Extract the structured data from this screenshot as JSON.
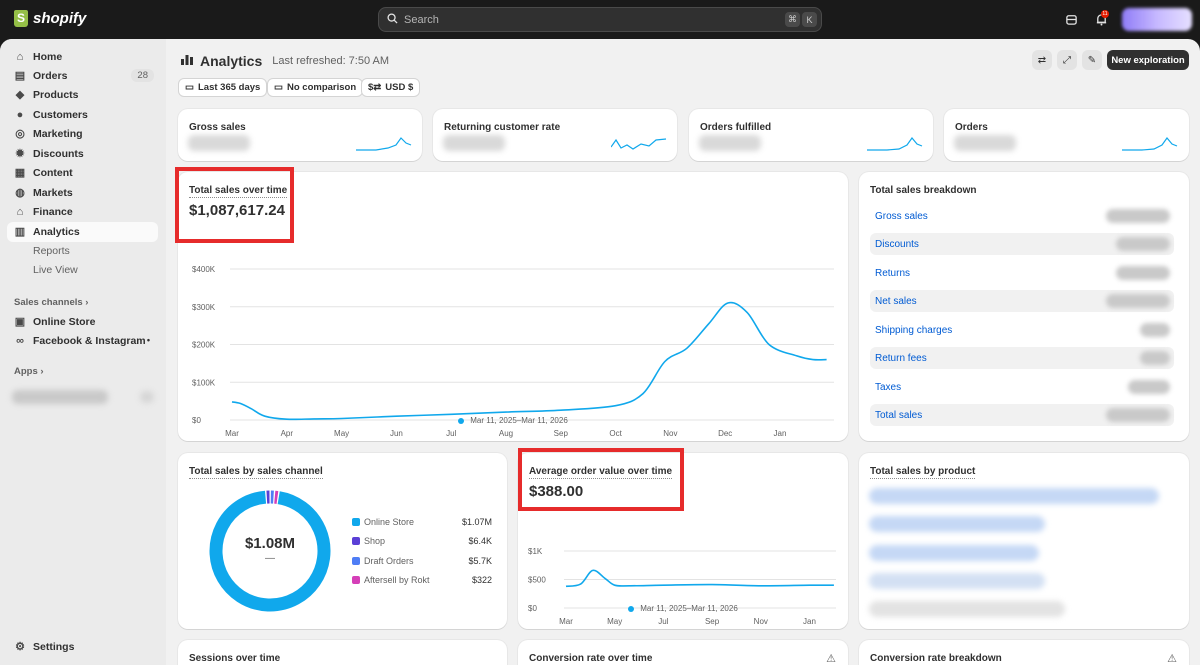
{
  "topbar": {
    "logo_text": "shopify",
    "search_placeholder": "Search",
    "kbd_cmd": "⌘",
    "kbd_k": "K",
    "notif_count": "11"
  },
  "sidebar": {
    "items": [
      {
        "label": "Home",
        "icon": "home-icon"
      },
      {
        "label": "Orders",
        "icon": "orders-icon",
        "count": "28"
      },
      {
        "label": "Products",
        "icon": "tag-icon"
      },
      {
        "label": "Customers",
        "icon": "person-icon"
      },
      {
        "label": "Marketing",
        "icon": "target-icon"
      },
      {
        "label": "Discounts",
        "icon": "discount-icon"
      },
      {
        "label": "Content",
        "icon": "content-icon"
      },
      {
        "label": "Markets",
        "icon": "globe-icon"
      },
      {
        "label": "Finance",
        "icon": "bank-icon"
      },
      {
        "label": "Analytics",
        "icon": "chart-icon"
      }
    ],
    "sub_items": [
      "Reports",
      "Live View"
    ],
    "sales_channels_label": "Sales channels",
    "channels": [
      "Online Store",
      "Facebook & Instagram"
    ],
    "apps_label": "Apps",
    "settings_label": "Settings"
  },
  "header": {
    "title": "Analytics",
    "refreshed": "Last refreshed: 7:50 AM",
    "new_exploration": "New exploration",
    "filters": [
      "Last 365 days",
      "No comparison",
      "USD $"
    ]
  },
  "metric_cards": [
    "Gross sales",
    "Returning customer rate",
    "Orders fulfilled",
    "Orders"
  ],
  "total_sales": {
    "title": "Total sales over time",
    "value": "$1,087,617.24",
    "legend": "Mar 11, 2025–Mar 11, 2026"
  },
  "breakdown": {
    "title": "Total sales breakdown",
    "rows": [
      "Gross sales",
      "Discounts",
      "Returns",
      "Net sales",
      "Shipping charges",
      "Return fees",
      "Taxes",
      "Total sales"
    ]
  },
  "channel_card": {
    "title": "Total sales by sales channel",
    "center_value": "$1.08M",
    "center_sub": "—",
    "legend": [
      {
        "name": "Online Store",
        "value": "$1.07M",
        "color": "#10a8ec"
      },
      {
        "name": "Shop",
        "value": "$6.4K",
        "color": "#5a3fd6"
      },
      {
        "name": "Draft Orders",
        "value": "$5.7K",
        "color": "#4f7df5"
      },
      {
        "name": "Aftersell by Rokt",
        "value": "$322",
        "color": "#d53fb8"
      }
    ]
  },
  "aov": {
    "title": "Average order value over time",
    "value": "$388.00",
    "legend": "Mar 11, 2025–Mar 11, 2026"
  },
  "product_card": {
    "title": "Total sales by product"
  },
  "bottom_cards": [
    "Sessions over time",
    "Conversion rate over time",
    "Conversion rate breakdown"
  ],
  "chart_data": [
    {
      "type": "line",
      "title": "Total sales over time",
      "x": [
        "Mar",
        "Apr",
        "May",
        "Jun",
        "Jul",
        "Aug",
        "Sep",
        "Oct",
        "Nov",
        "Dec",
        "Jan"
      ],
      "yticks": [
        "$0",
        "$100K",
        "$200K",
        "$300K",
        "$400K"
      ],
      "ylim": [
        0,
        400000
      ],
      "series": [
        {
          "name": "Mar 11, 2025–Mar 11, 2026",
          "color": "#10a8ec",
          "x": [
            0,
            0.15,
            0.35,
            0.6,
            1,
            1.5,
            2,
            3,
            4,
            5,
            6,
            7,
            7.5,
            7.9,
            8.3,
            8.7,
            9.05,
            9.4,
            9.8,
            10.3,
            10.6,
            10.85
          ],
          "values": [
            48000,
            44000,
            30000,
            10000,
            2000,
            3000,
            4000,
            10000,
            15000,
            21000,
            26000,
            38000,
            70000,
            155000,
            190000,
            255000,
            310000,
            285000,
            200000,
            170000,
            160000,
            160000
          ]
        }
      ],
      "grid": true
    },
    {
      "type": "line",
      "title": "Average order value over time",
      "x": [
        "Mar",
        "May",
        "Jul",
        "Sep",
        "Nov",
        "Jan"
      ],
      "yticks": [
        "$0",
        "$500",
        "$1K"
      ],
      "ylim": [
        0,
        1000
      ],
      "series": [
        {
          "name": "Mar 11, 2025–Mar 11, 2026",
          "color": "#10a8ec",
          "x": [
            0,
            0.3,
            0.55,
            0.8,
            1.0,
            1.3,
            2,
            3,
            4,
            5,
            5.5
          ],
          "values": [
            380,
            420,
            660,
            520,
            400,
            390,
            400,
            410,
            390,
            400,
            400
          ]
        }
      ],
      "grid": true
    },
    {
      "type": "pie",
      "title": "Total sales by sales channel",
      "categories": [
        "Online Store",
        "Shop",
        "Draft Orders",
        "Aftersell by Rokt"
      ],
      "values": [
        1070000,
        6400,
        5700,
        322
      ],
      "colors": [
        "#10a8ec",
        "#5a3fd6",
        "#4f7df5",
        "#d53fb8"
      ]
    }
  ]
}
